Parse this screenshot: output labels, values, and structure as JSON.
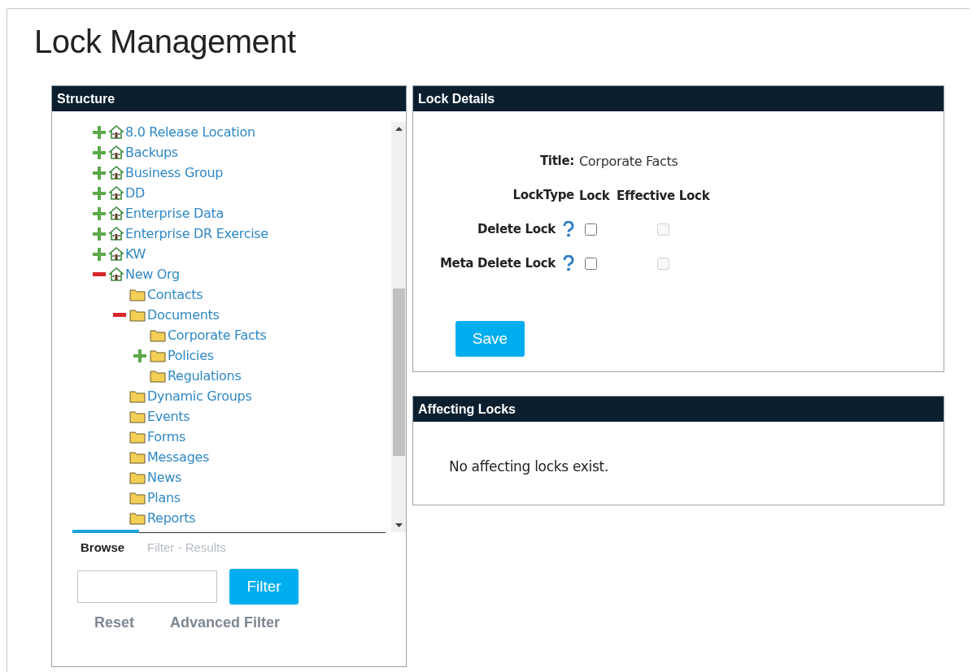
{
  "page": {
    "title": "Lock Management"
  },
  "structure": {
    "title": "Structure",
    "tree": [
      {
        "label": "8.0 Release Location",
        "kind": "site",
        "expandable": true,
        "expanded": false
      },
      {
        "label": "Backups",
        "kind": "site",
        "expandable": true,
        "expanded": false
      },
      {
        "label": "Business Group",
        "kind": "site",
        "expandable": true,
        "expanded": false
      },
      {
        "label": "DD",
        "kind": "site",
        "expandable": true,
        "expanded": false
      },
      {
        "label": "Enterprise Data",
        "kind": "site",
        "expandable": true,
        "expanded": false
      },
      {
        "label": "Enterprise DR Exercise",
        "kind": "site",
        "expandable": true,
        "expanded": false
      },
      {
        "label": "KW",
        "kind": "site",
        "expandable": true,
        "expanded": false
      },
      {
        "label": "New Org",
        "kind": "site",
        "expandable": true,
        "expanded": true,
        "children": [
          {
            "label": "Contacts",
            "kind": "folder",
            "expandable": false,
            "expanded": false
          },
          {
            "label": "Documents",
            "kind": "folder",
            "expandable": true,
            "expanded": true,
            "children": [
              {
                "label": "Corporate Facts",
                "kind": "folder",
                "expandable": false,
                "expanded": false
              },
              {
                "label": "Policies",
                "kind": "folder",
                "expandable": true,
                "expanded": false
              },
              {
                "label": "Regulations",
                "kind": "folder",
                "expandable": false,
                "expanded": false
              }
            ]
          },
          {
            "label": "Dynamic Groups",
            "kind": "folder",
            "expandable": false,
            "expanded": false
          },
          {
            "label": "Events",
            "kind": "folder",
            "expandable": false,
            "expanded": false
          },
          {
            "label": "Forms",
            "kind": "folder",
            "expandable": false,
            "expanded": false
          },
          {
            "label": "Messages",
            "kind": "folder",
            "expandable": false,
            "expanded": false
          },
          {
            "label": "News",
            "kind": "folder",
            "expandable": false,
            "expanded": false
          },
          {
            "label": "Plans",
            "kind": "folder",
            "expandable": false,
            "expanded": false
          },
          {
            "label": "Reports",
            "kind": "folder",
            "expandable": false,
            "expanded": false
          }
        ]
      }
    ],
    "tabs": [
      {
        "label": "Browse",
        "selected": true
      },
      {
        "label": "Filter - Results",
        "selected": false
      }
    ],
    "filter_button": "Filter",
    "links": [
      "Reset",
      "Advanced Filter"
    ]
  },
  "lock_details": {
    "title": "Lock Details",
    "title_label": "Title:",
    "title_value": "Corporate Facts",
    "columns": [
      "LockType",
      "Lock",
      "Effective Lock"
    ],
    "rows": [
      {
        "label": "Delete Lock",
        "lock_checked": false,
        "effective_checked": false,
        "effective_disabled": true
      },
      {
        "label": "Meta Delete Lock",
        "lock_checked": false,
        "effective_checked": false,
        "effective_disabled": true
      }
    ],
    "save_button": "Save"
  },
  "affecting_locks": {
    "title": "Affecting Locks",
    "message": "No affecting locks exist."
  }
}
